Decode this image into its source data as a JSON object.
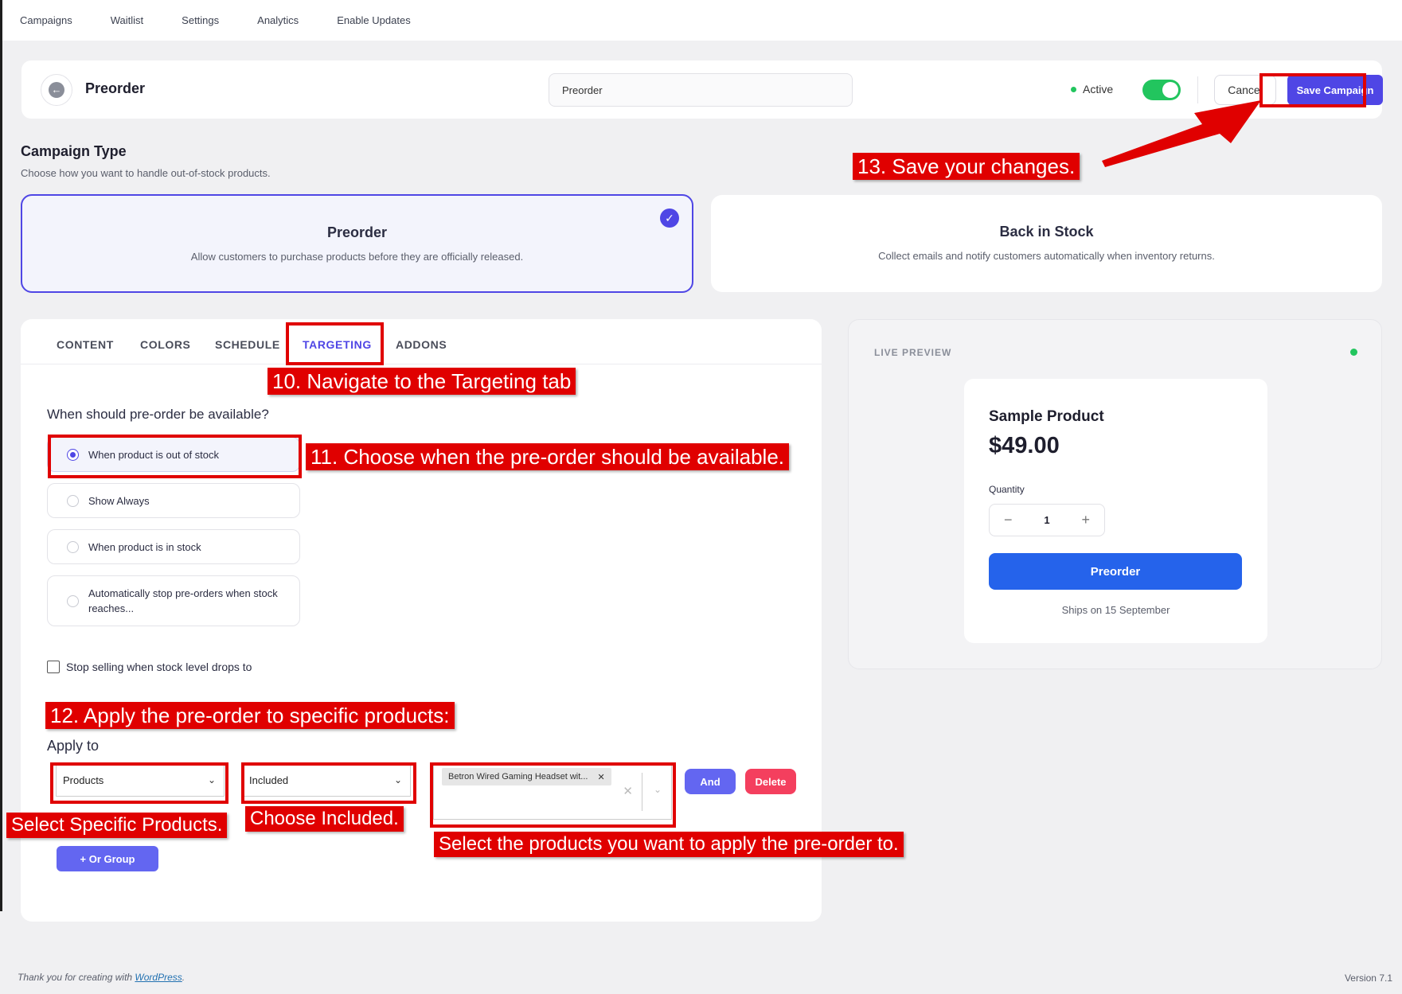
{
  "topnav": [
    "Campaigns",
    "Waitlist",
    "Settings",
    "Analytics",
    "Enable Updates"
  ],
  "header": {
    "title": "Preorder",
    "name_value": "Preorder",
    "status": "Active",
    "cancel": "Cancel",
    "save": "Save Campaign"
  },
  "campaign_type": {
    "title": "Campaign Type",
    "subtitle": "Choose how you want to handle out-of-stock products.",
    "options": [
      {
        "title": "Preorder",
        "desc": "Allow customers to purchase products before they are officially released.",
        "selected": true
      },
      {
        "title": "Back in Stock",
        "desc": "Collect emails and notify customers automatically when inventory returns.",
        "selected": false
      }
    ]
  },
  "tabs": [
    "CONTENT",
    "COLORS",
    "SCHEDULE",
    "TARGETING",
    "ADDONS"
  ],
  "active_tab": "TARGETING",
  "targeting": {
    "question": "When should pre-order be available?",
    "options": [
      {
        "label": "When product is out of stock",
        "selected": true
      },
      {
        "label": "Show Always",
        "selected": false
      },
      {
        "label": "When product is in stock",
        "selected": false
      },
      {
        "label": "Automatically stop pre-orders when stock reaches...",
        "selected": false
      }
    ],
    "stop_selling": "Stop selling when stock level drops to",
    "apply_to": "Apply to",
    "apply_select": "Products",
    "include_select": "Included",
    "chip": "Betron Wired Gaming Headset wit...",
    "and": "And",
    "delete": "Delete",
    "or_group": "+ Or Group"
  },
  "preview": {
    "label": "LIVE PREVIEW",
    "product_name": "Sample Product",
    "price": "$49.00",
    "quantity_label": "Quantity",
    "quantity": "1",
    "button": "Preorder",
    "ships": "Ships on 15 September"
  },
  "annotations": {
    "a10": "10. Navigate to the Targeting tab",
    "a11": "11. Choose when the pre-order should be available.",
    "a12": "12. Apply the pre-order to specific products:",
    "a13": "13. Save your changes.",
    "products": "Select Specific Products.",
    "included": "Choose Included.",
    "select_products": "Select the products you want to apply the pre-order to."
  },
  "footer": {
    "thanks_prefix": "Thank you for creating with ",
    "wordpress": "WordPress",
    "thanks_suffix": ".",
    "version": "Version 7.1"
  },
  "colors": {
    "accent": "#4f46e5",
    "active_green": "#22c55e",
    "preview_button": "#2563eb",
    "annotation_red": "#e00000",
    "delete_red": "#f43f5e"
  }
}
